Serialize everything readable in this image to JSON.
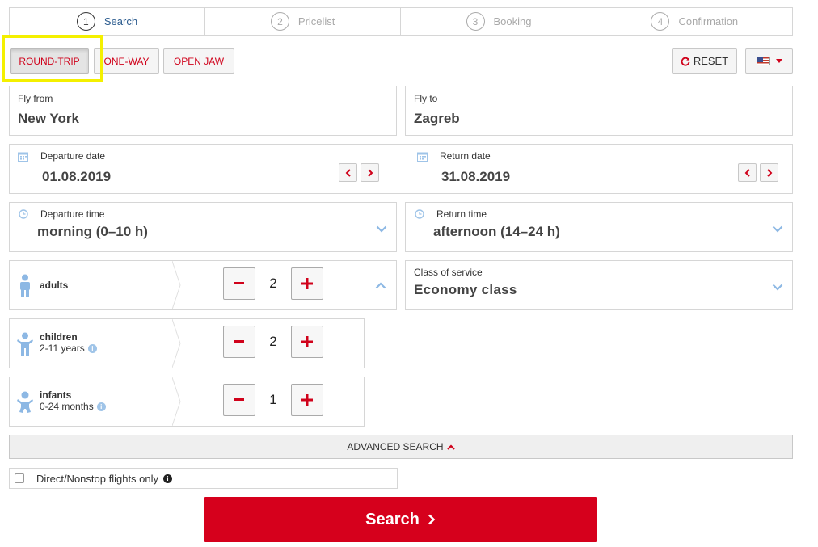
{
  "steps": [
    {
      "num": "1",
      "label": "Search"
    },
    {
      "num": "2",
      "label": "Pricelist"
    },
    {
      "num": "3",
      "label": "Booking"
    },
    {
      "num": "4",
      "label": "Confirmation"
    }
  ],
  "trip_types": {
    "round_trip": "ROUND-TRIP",
    "one_way": "ONE-WAY",
    "open_jaw": "OPEN JAW",
    "selected": "ROUND-TRIP"
  },
  "toolbar": {
    "reset_label": "RESET",
    "language_icon": "us-flag-icon"
  },
  "fly_from": {
    "label": "Fly from",
    "value": "New York"
  },
  "fly_to": {
    "label": "Fly to",
    "value": "Zagreb"
  },
  "departure_date": {
    "label": "Departure date",
    "value": "01.08.2019"
  },
  "return_date": {
    "label": "Return date",
    "value": "31.08.2019"
  },
  "departure_time": {
    "label": "Departure time",
    "value": "morning (0–10 h)"
  },
  "return_time": {
    "label": "Return time",
    "value": "afternoon (14–24 h)"
  },
  "passengers": {
    "adults": {
      "label": "adults",
      "count": "2"
    },
    "children": {
      "label": "children",
      "sub": "2-11 years",
      "count": "2"
    },
    "infants": {
      "label": "infants",
      "sub": "0-24 months",
      "count": "1"
    }
  },
  "class_of_service": {
    "label": "Class of service",
    "value": "Economy class"
  },
  "advanced_search_label": "ADVANCED SEARCH",
  "nonstop_label": "Direct/Nonstop flights only",
  "search_button_label": "Search",
  "colors": {
    "accent_red": "#d6001c",
    "step_active": "#2c5c8f",
    "icon_blue": "#8db8e4",
    "highlight": "#f4f000"
  }
}
